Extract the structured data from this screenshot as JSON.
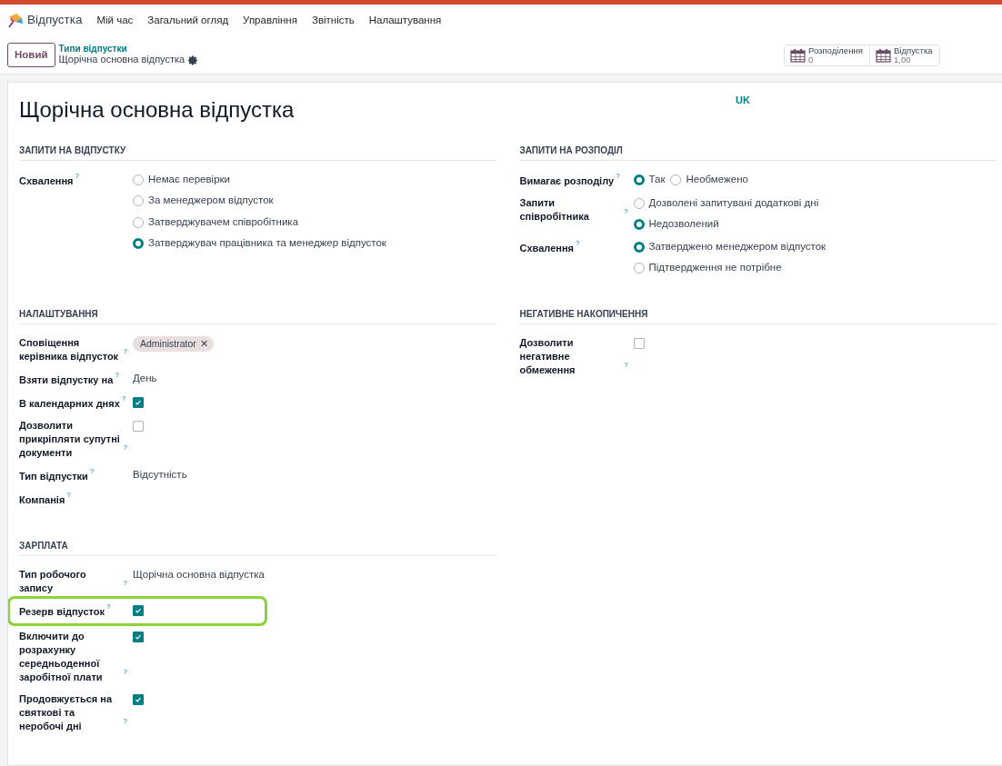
{
  "app": {
    "name": "Відпустка",
    "menu": [
      "Мій час",
      "Загальний огляд",
      "Управління",
      "Звітність",
      "Налаштування"
    ]
  },
  "control_panel": {
    "new_button": "Новий",
    "breadcrumb": "Типи відпустки",
    "record": "Щорічна основна відпустка",
    "stats": [
      {
        "label": "Розподілення",
        "value": "0"
      },
      {
        "label": "Відпустка",
        "value": "1,00"
      }
    ]
  },
  "form": {
    "title": "Щорічна основна відпустка",
    "language": "UK",
    "rows": [
      [
        {
          "title": "ЗАПИТИ НА ВІДПУСТКУ",
          "fields": [
            {
              "label": "Схвалення",
              "help": "?",
              "kind": "radio",
              "inline": false,
              "highlighted": false,
              "options": [
                {
                  "label": "Немає перевірки",
                  "selected": false
                },
                {
                  "label": "За менеджером відпусток",
                  "selected": false
                },
                {
                  "label": "Затверджувачем співробітника",
                  "selected": false
                },
                {
                  "label": "Затверджувач працівника та менеджер відпусток",
                  "selected": true
                }
              ]
            }
          ]
        },
        {
          "title": "ЗАПИТИ НА РОЗПОДІЛ",
          "fields": [
            {
              "label": "Вимагає розподілу",
              "help": "?",
              "kind": "radio",
              "inline": true,
              "highlighted": false,
              "options": [
                {
                  "label": "Так",
                  "selected": true
                },
                {
                  "label": "Необмежено",
                  "selected": false
                }
              ]
            },
            {
              "label": "Запити співробітника",
              "help": "?",
              "kind": "radio",
              "inline": false,
              "highlighted": false,
              "options": [
                {
                  "label": "Дозволені запитувані додаткові дні",
                  "selected": false
                },
                {
                  "label": "Недозволений",
                  "selected": true
                }
              ]
            },
            {
              "label": "Схвалення",
              "help": "?",
              "kind": "radio",
              "inline": false,
              "highlighted": false,
              "options": [
                {
                  "label": "Затверджено менеджером відпусток",
                  "selected": true
                },
                {
                  "label": "Підтвердження не потрібне",
                  "selected": false
                }
              ]
            }
          ]
        }
      ],
      [
        {
          "title": "НАЛАШТУВАННЯ",
          "fields": [
            {
              "label": "Сповіщення керівника відпусток",
              "help": "?",
              "kind": "tag",
              "highlighted": false,
              "value": "Administrator",
              "remove": "✕"
            },
            {
              "label": "Взяти відпустку на",
              "help": "?",
              "kind": "text",
              "highlighted": false,
              "value": "День"
            },
            {
              "label": "В календарних днях",
              "help": "?",
              "kind": "checkbox",
              "highlighted": false,
              "checked": true
            },
            {
              "label": "Дозволити прикріпляти супутні документи",
              "help": "?",
              "kind": "checkbox",
              "highlighted": false,
              "checked": false
            },
            {
              "label": "Тип відпустки",
              "help": "?",
              "kind": "text",
              "highlighted": false,
              "value": "Відсутність"
            },
            {
              "label": "Компанія",
              "help": "?",
              "kind": "empty",
              "highlighted": false
            }
          ]
        },
        {
          "title": "НЕГАТИВНЕ НАКОПИЧЕННЯ",
          "fields": [
            {
              "label": "Дозволити негативне обмеження",
              "help": "?",
              "kind": "checkbox",
              "highlighted": false,
              "checked": false
            }
          ]
        }
      ],
      [
        {
          "title": "ЗАРПЛАТА",
          "fields": [
            {
              "label": "Тип робочого запису",
              "help": "?",
              "kind": "text",
              "highlighted": false,
              "value": "Щорічна основна відпустка"
            },
            {
              "label": "Резерв відпусток",
              "help": "?",
              "kind": "checkbox",
              "highlighted": true,
              "checked": true
            },
            {
              "label": "Включити до розрахунку середньоденної заробітної плати",
              "help": "?",
              "kind": "checkbox",
              "highlighted": false,
              "checked": true
            },
            {
              "label": "Продовжується на святкові та неробочі дні",
              "help": "?",
              "kind": "checkbox",
              "highlighted": false,
              "checked": true
            }
          ]
        }
      ]
    ]
  }
}
